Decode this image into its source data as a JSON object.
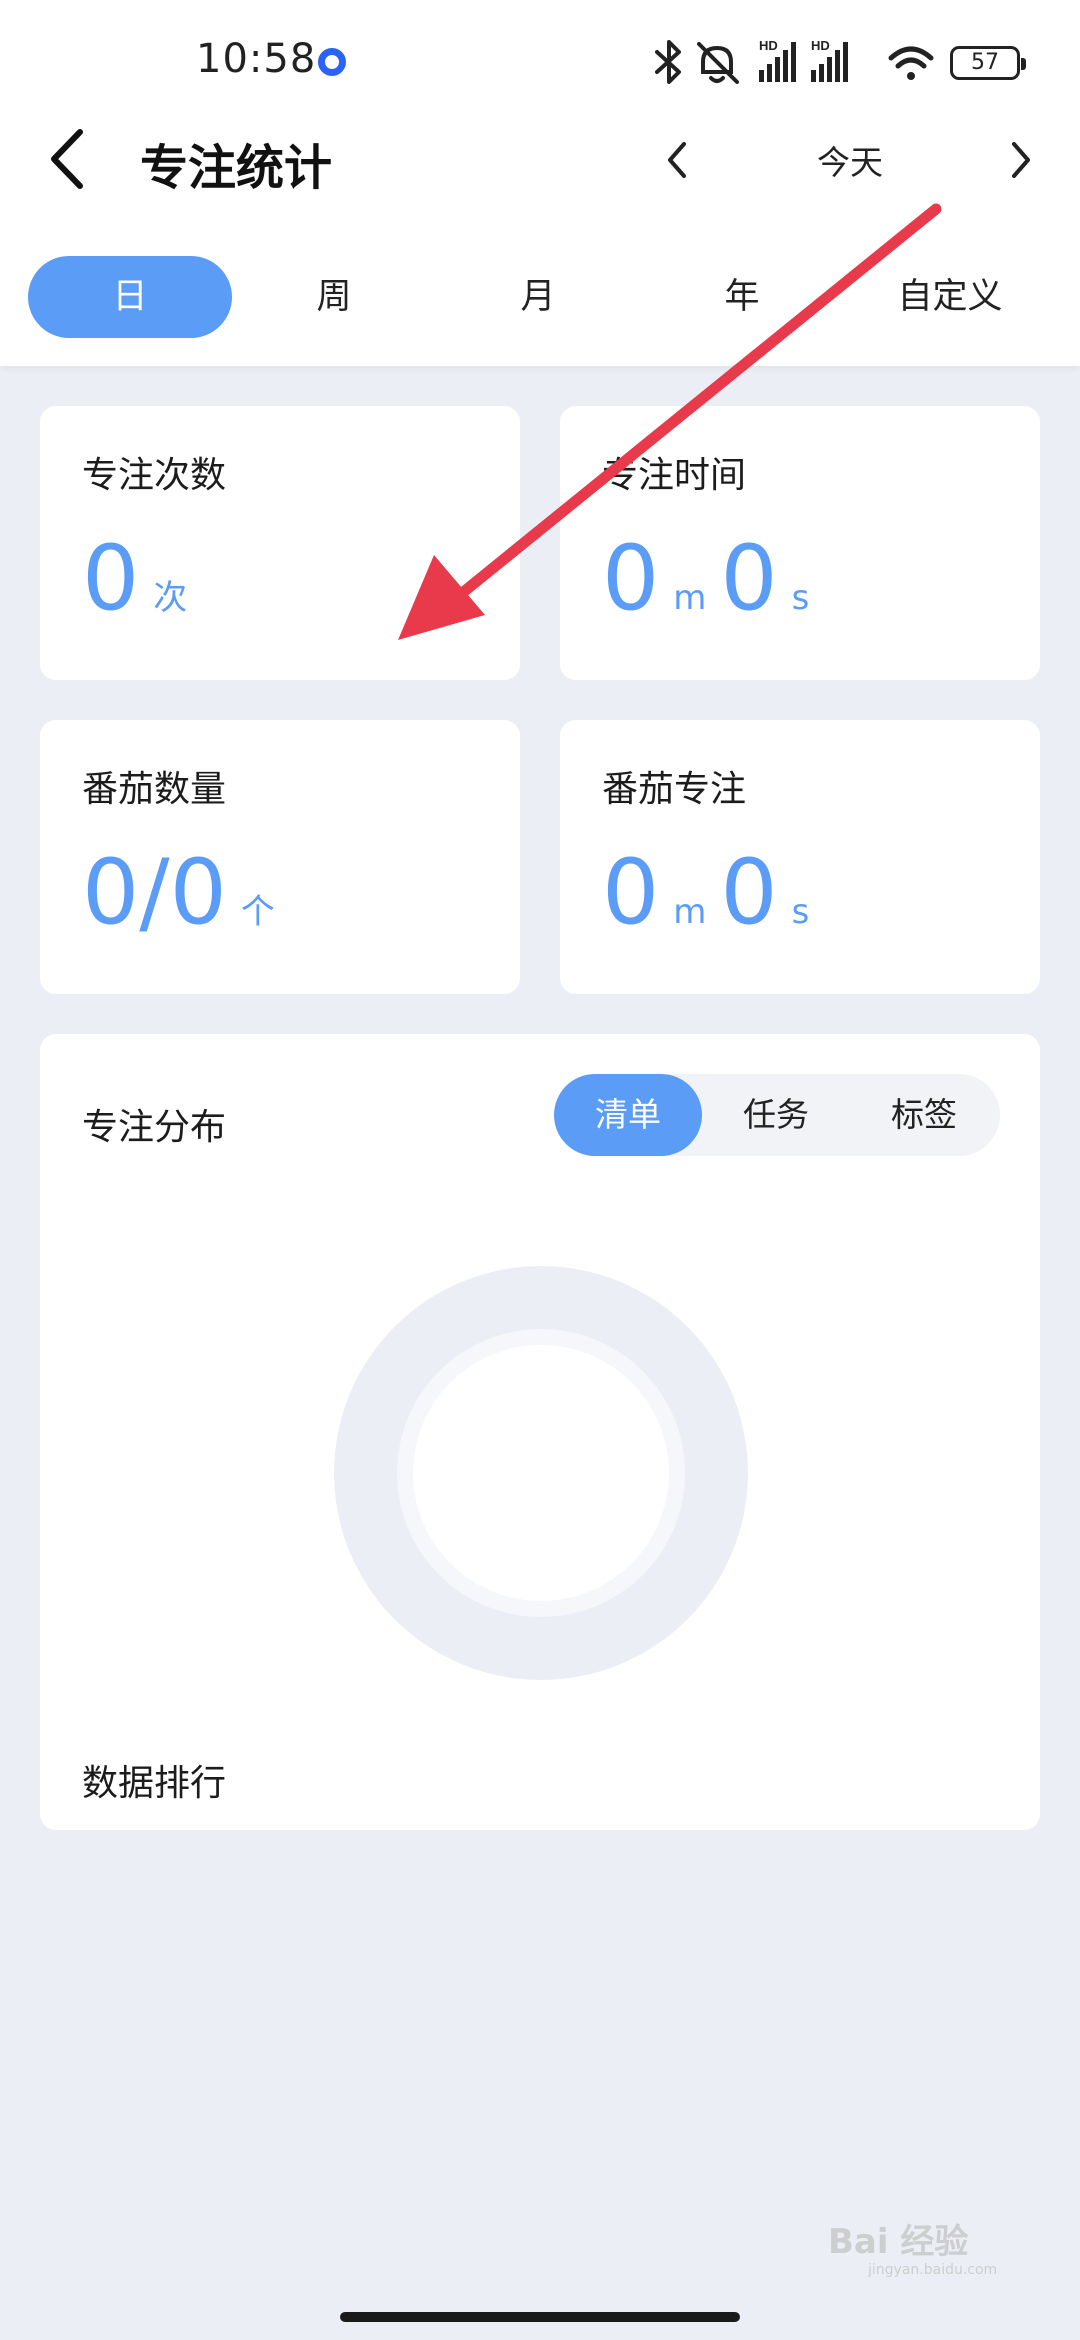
{
  "status_bar": {
    "time": "10:58",
    "battery": "57",
    "icons": [
      "notification-dot-icon",
      "bluetooth-icon",
      "mute-icon",
      "hd-signal-icon",
      "hd-signal-icon",
      "wifi-icon",
      "battery-icon"
    ],
    "hd_label": "HD"
  },
  "header": {
    "title": "专注统计",
    "date_label": "今天"
  },
  "period_tabs": [
    {
      "label": "日",
      "active": true
    },
    {
      "label": "周",
      "active": false
    },
    {
      "label": "月",
      "active": false
    },
    {
      "label": "年",
      "active": false
    },
    {
      "label": "自定义",
      "active": false
    }
  ],
  "stats": {
    "focus_count": {
      "label": "专注次数",
      "value": "0",
      "unit": "次"
    },
    "focus_time": {
      "label": "专注时间",
      "minutes": "0",
      "minutes_unit": "m",
      "seconds": "0",
      "seconds_unit": "s"
    },
    "tomato_count": {
      "label": "番茄数量",
      "value": "0/0",
      "unit": "个"
    },
    "tomato_focus": {
      "label": "番茄专注",
      "minutes": "0",
      "minutes_unit": "m",
      "seconds": "0",
      "seconds_unit": "s"
    }
  },
  "distribution": {
    "title": "专注分布",
    "segments": [
      {
        "label": "清单",
        "active": true
      },
      {
        "label": "任务",
        "active": false
      },
      {
        "label": "标签",
        "active": false
      }
    ]
  },
  "ranking": {
    "title": "数据排行"
  },
  "watermark": {
    "text": "Bai 经验",
    "sub": "jingyan.baidu.com"
  },
  "colors": {
    "accent": "#5b9cf6",
    "background": "#ebeff5",
    "annotation_arrow": "#e83a4b"
  }
}
